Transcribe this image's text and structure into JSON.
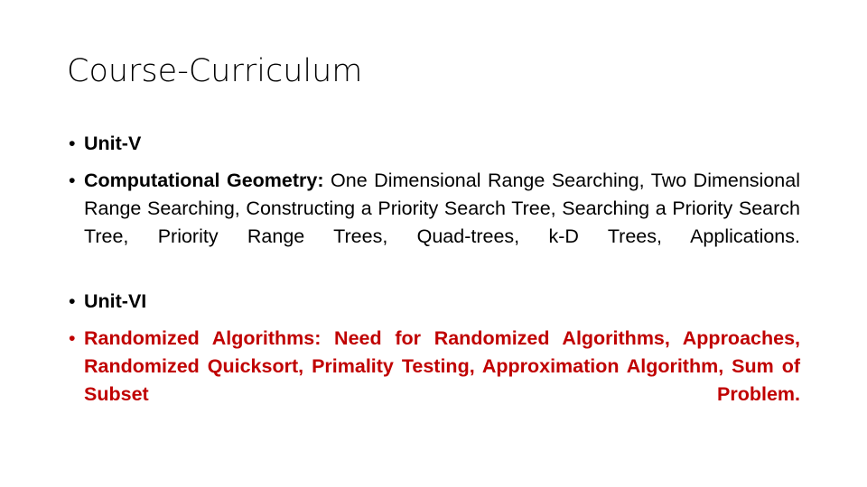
{
  "slide": {
    "title": "Course-Curriculum",
    "background_color": "#FFFFFF",
    "body_text_color": "#000000",
    "accent_color": "#C00000",
    "bullet_glyph": "•",
    "bullets": [
      {
        "id": "unit-v",
        "marker": "•",
        "heading": "Unit-V",
        "rest": "",
        "color": "#000000",
        "justified": false
      },
      {
        "id": "computational-geometry",
        "marker": "•",
        "heading": "Computational Geometry:",
        "rest": " One Dimensional Range Searching, Two Dimensional Range Searching, Constructing a Priority Search Tree, Searching a Priority Search Tree, Priority Range Trees, Quad-trees, k-D Trees, Applications.",
        "color": "#000000",
        "justified": true
      },
      {
        "id": "unit-vi",
        "marker": "•",
        "heading": "Unit-VI",
        "rest": "",
        "color": "#000000",
        "justified": false
      },
      {
        "id": "randomized-algorithms",
        "marker": "•",
        "heading": "Randomized Algorithms:",
        "rest": " Need for Randomized Algorithms, Approaches, Randomized Quicksort, Primality Testing, Approximation Algorithm, Sum of Subset Problem.",
        "color": "#C00000",
        "justified": true
      }
    ]
  }
}
